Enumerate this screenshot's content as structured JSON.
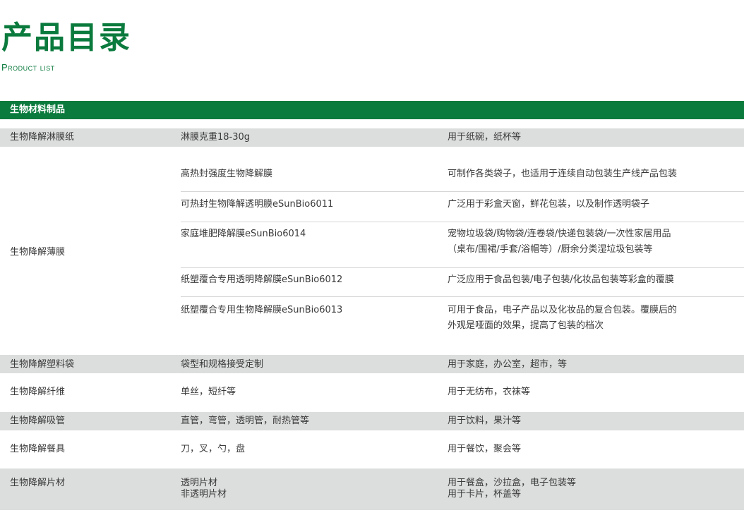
{
  "header": {
    "title": "产品目录",
    "subtitle": "Product list"
  },
  "section": {
    "name": "生物材料制品"
  },
  "rows": [
    {
      "category": "生物降解淋膜纸",
      "spec": "淋膜克重18-30g",
      "usage": "用于纸碗，纸杯等"
    },
    {
      "category": "生物降解薄膜",
      "items": [
        {
          "spec": "高热封强度生物降解膜",
          "usage": [
            "可制作各类袋子，也适用于连续自动包装生产线产品包装"
          ]
        },
        {
          "spec": "可热封生物降解透明膜eSunBio6011",
          "usage": [
            "广泛用于彩盒天窗，鲜花包装，以及制作透明袋子"
          ]
        },
        {
          "spec": "家庭堆肥降解膜eSunBio6014",
          "usage": [
            "宠物垃圾袋/购物袋/连卷袋/快递包装袋/一次性家居用品",
            "（桌布/围裙/手套/浴帽等）/厨余分类湿垃圾包装等"
          ]
        },
        {
          "spec": "纸塑覆合专用透明降解膜eSunBio6012",
          "usage": [
            "广泛应用于食品包装/电子包装/化妆品包装等彩盒的覆膜"
          ]
        },
        {
          "spec": "纸塑覆合专用生物降解膜eSunBio6013",
          "usage": [
            "可用于食品，电子产品以及化妆品的复合包装。覆膜后的",
            "外观是哑面的效果，提高了包装的档次"
          ]
        }
      ]
    },
    {
      "category": "生物降解塑料袋",
      "spec": "袋型和规格接受定制",
      "usage": "用于家庭，办公室，超市，等"
    },
    {
      "category": "生物降解纤维",
      "spec": "单丝，短纤等",
      "usage": "用于无纺布，衣袜等"
    },
    {
      "category": "生物降解吸管",
      "spec": "直管，弯管，透明管，耐热管等",
      "usage": "用于饮料，果汁等"
    },
    {
      "category": "生物降解餐具",
      "spec": "刀，叉，勺，盘",
      "usage": "用于餐饮，聚会等"
    },
    {
      "category": "生物降解片材",
      "spec": [
        "透明片材",
        "非透明片材"
      ],
      "usage": [
        "用于餐盒，沙拉盒，电子包装等",
        "用于卡片，杯盖等"
      ]
    }
  ],
  "colors": {
    "brand_green": "#0a7a3d",
    "row_grey": "#dcdddd"
  }
}
